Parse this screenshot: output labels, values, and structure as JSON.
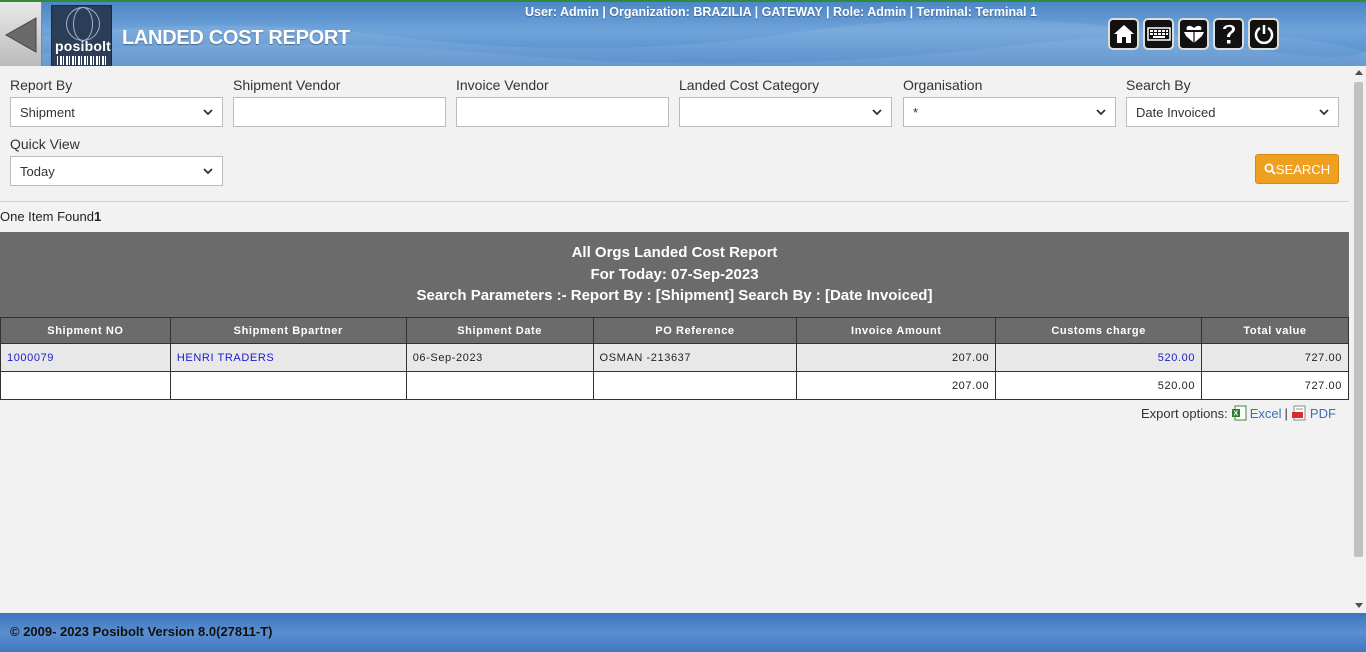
{
  "header": {
    "title": "LANDED COST REPORT",
    "logo_text": "posibolt",
    "user_info": "User: Admin | Organization: BRAZILIA | GATEWAY | Role: Admin | Terminal: Terminal 1",
    "icons": [
      "home-icon",
      "keyboard-icon",
      "gift-icon",
      "help-icon",
      "power-icon"
    ]
  },
  "filters": {
    "report_by": {
      "label": "Report By",
      "value": "Shipment"
    },
    "shipment_vendor": {
      "label": "Shipment Vendor",
      "value": ""
    },
    "invoice_vendor": {
      "label": "Invoice Vendor",
      "value": ""
    },
    "landed_cost_category": {
      "label": "Landed Cost Category",
      "value": ""
    },
    "organisation": {
      "label": "Organisation",
      "value": "*"
    },
    "search_by": {
      "label": "Search By",
      "value": "Date Invoiced"
    },
    "quick_view": {
      "label": "Quick View",
      "value": "Today"
    },
    "search_button": "SEARCH"
  },
  "results": {
    "found_text": "One Item Found",
    "count": "1"
  },
  "report": {
    "title": "All Orgs Landed Cost Report",
    "subtitle": "For Today: 07-Sep-2023",
    "params": "Search Parameters :- Report By : [Shipment] Search By : [Date Invoiced]",
    "columns": [
      "Shipment NO",
      "Shipment Bpartner",
      "Shipment Date",
      "PO Reference",
      "Invoice Amount",
      "Customs charge",
      "Total value"
    ],
    "rows": [
      {
        "shipment_no": "1000079",
        "bpartner": "HENRI TRADERS",
        "date": "06-Sep-2023",
        "po_ref": "OSMAN -213637",
        "invoice_amount": "207.00",
        "customs_charge": "520.00",
        "total_value": "727.00"
      }
    ],
    "totals": {
      "invoice_amount": "207.00",
      "customs_charge": "520.00",
      "total_value": "727.00"
    }
  },
  "export": {
    "label": "Export options:",
    "excel": "Excel",
    "separator": "|",
    "pdf": "PDF"
  },
  "footer": {
    "text": "© 2009- 2023 Posibolt Version  8.0(27811-T)"
  },
  "colors": {
    "header_blue": "#5b93d1",
    "search_orange": "#f0a020",
    "report_gray": "#6b6b6b",
    "link_blue": "#1a1acc"
  }
}
